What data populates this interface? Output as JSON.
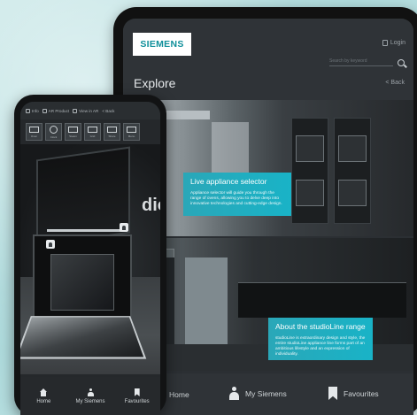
{
  "tablet": {
    "brand": "SIEMENS",
    "login": "Login",
    "search_placeholder": "Search by keyword",
    "title": "Explore",
    "back": "< Back",
    "cards": [
      {
        "heading": "Live appliance selector",
        "text": "Appliance selector will guide you through the range of ovens, allowing you to delve deep into innovative technologies and cutting-edge design."
      },
      {
        "heading": "About the studioLine range",
        "text": "studioLine is extraordinary design and style, the entire studioLine appliance line forms part of an ambitious lifestyle and an expression of individuality."
      }
    ],
    "nav": {
      "home": "Home",
      "my_siemens": "My Siemens",
      "favourites": "Favourites"
    }
  },
  "phone": {
    "top": {
      "info": "Info",
      "product": "AR Product",
      "view": "View in AR",
      "back": "< Back"
    },
    "tools": [
      {
        "label": "Oven",
        "icon": "oven-icon"
      },
      {
        "label": "Clock",
        "icon": "clock-icon"
      },
      {
        "label": "Steam",
        "icon": "steam-icon"
      },
      {
        "label": "Grid",
        "icon": "grid-icon"
      },
      {
        "label": "Share",
        "icon": "share-icon"
      },
      {
        "label": "Menu",
        "icon": "menu-icon"
      }
    ],
    "ghost_text": "dio",
    "nav": {
      "home": "Home",
      "my_siemens": "My Siemens",
      "favourites": "Favourites"
    }
  },
  "colors": {
    "accent": "#19b3c7",
    "brand": "#0f8f9a",
    "dark_bg": "#2f3337"
  }
}
